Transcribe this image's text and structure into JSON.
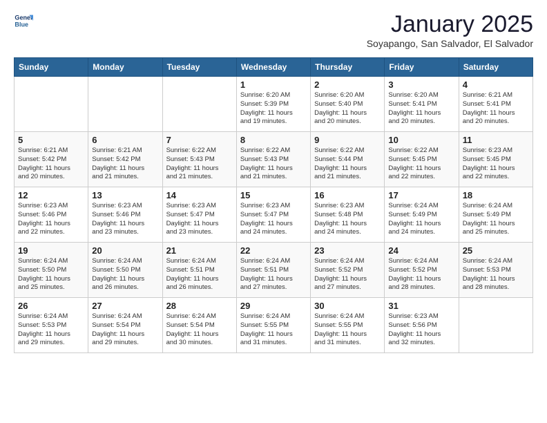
{
  "logo": {
    "line1": "General",
    "line2": "Blue"
  },
  "title": "January 2025",
  "location": "Soyapango, San Salvador, El Salvador",
  "days_of_week": [
    "Sunday",
    "Monday",
    "Tuesday",
    "Wednesday",
    "Thursday",
    "Friday",
    "Saturday"
  ],
  "weeks": [
    [
      {
        "day": "",
        "info": ""
      },
      {
        "day": "",
        "info": ""
      },
      {
        "day": "",
        "info": ""
      },
      {
        "day": "1",
        "info": "Sunrise: 6:20 AM\nSunset: 5:39 PM\nDaylight: 11 hours\nand 19 minutes."
      },
      {
        "day": "2",
        "info": "Sunrise: 6:20 AM\nSunset: 5:40 PM\nDaylight: 11 hours\nand 20 minutes."
      },
      {
        "day": "3",
        "info": "Sunrise: 6:20 AM\nSunset: 5:41 PM\nDaylight: 11 hours\nand 20 minutes."
      },
      {
        "day": "4",
        "info": "Sunrise: 6:21 AM\nSunset: 5:41 PM\nDaylight: 11 hours\nand 20 minutes."
      }
    ],
    [
      {
        "day": "5",
        "info": "Sunrise: 6:21 AM\nSunset: 5:42 PM\nDaylight: 11 hours\nand 20 minutes."
      },
      {
        "day": "6",
        "info": "Sunrise: 6:21 AM\nSunset: 5:42 PM\nDaylight: 11 hours\nand 21 minutes."
      },
      {
        "day": "7",
        "info": "Sunrise: 6:22 AM\nSunset: 5:43 PM\nDaylight: 11 hours\nand 21 minutes."
      },
      {
        "day": "8",
        "info": "Sunrise: 6:22 AM\nSunset: 5:43 PM\nDaylight: 11 hours\nand 21 minutes."
      },
      {
        "day": "9",
        "info": "Sunrise: 6:22 AM\nSunset: 5:44 PM\nDaylight: 11 hours\nand 21 minutes."
      },
      {
        "day": "10",
        "info": "Sunrise: 6:22 AM\nSunset: 5:45 PM\nDaylight: 11 hours\nand 22 minutes."
      },
      {
        "day": "11",
        "info": "Sunrise: 6:23 AM\nSunset: 5:45 PM\nDaylight: 11 hours\nand 22 minutes."
      }
    ],
    [
      {
        "day": "12",
        "info": "Sunrise: 6:23 AM\nSunset: 5:46 PM\nDaylight: 11 hours\nand 22 minutes."
      },
      {
        "day": "13",
        "info": "Sunrise: 6:23 AM\nSunset: 5:46 PM\nDaylight: 11 hours\nand 23 minutes."
      },
      {
        "day": "14",
        "info": "Sunrise: 6:23 AM\nSunset: 5:47 PM\nDaylight: 11 hours\nand 23 minutes."
      },
      {
        "day": "15",
        "info": "Sunrise: 6:23 AM\nSunset: 5:47 PM\nDaylight: 11 hours\nand 24 minutes."
      },
      {
        "day": "16",
        "info": "Sunrise: 6:23 AM\nSunset: 5:48 PM\nDaylight: 11 hours\nand 24 minutes."
      },
      {
        "day": "17",
        "info": "Sunrise: 6:24 AM\nSunset: 5:49 PM\nDaylight: 11 hours\nand 24 minutes."
      },
      {
        "day": "18",
        "info": "Sunrise: 6:24 AM\nSunset: 5:49 PM\nDaylight: 11 hours\nand 25 minutes."
      }
    ],
    [
      {
        "day": "19",
        "info": "Sunrise: 6:24 AM\nSunset: 5:50 PM\nDaylight: 11 hours\nand 25 minutes."
      },
      {
        "day": "20",
        "info": "Sunrise: 6:24 AM\nSunset: 5:50 PM\nDaylight: 11 hours\nand 26 minutes."
      },
      {
        "day": "21",
        "info": "Sunrise: 6:24 AM\nSunset: 5:51 PM\nDaylight: 11 hours\nand 26 minutes."
      },
      {
        "day": "22",
        "info": "Sunrise: 6:24 AM\nSunset: 5:51 PM\nDaylight: 11 hours\nand 27 minutes."
      },
      {
        "day": "23",
        "info": "Sunrise: 6:24 AM\nSunset: 5:52 PM\nDaylight: 11 hours\nand 27 minutes."
      },
      {
        "day": "24",
        "info": "Sunrise: 6:24 AM\nSunset: 5:52 PM\nDaylight: 11 hours\nand 28 minutes."
      },
      {
        "day": "25",
        "info": "Sunrise: 6:24 AM\nSunset: 5:53 PM\nDaylight: 11 hours\nand 28 minutes."
      }
    ],
    [
      {
        "day": "26",
        "info": "Sunrise: 6:24 AM\nSunset: 5:53 PM\nDaylight: 11 hours\nand 29 minutes."
      },
      {
        "day": "27",
        "info": "Sunrise: 6:24 AM\nSunset: 5:54 PM\nDaylight: 11 hours\nand 29 minutes."
      },
      {
        "day": "28",
        "info": "Sunrise: 6:24 AM\nSunset: 5:54 PM\nDaylight: 11 hours\nand 30 minutes."
      },
      {
        "day": "29",
        "info": "Sunrise: 6:24 AM\nSunset: 5:55 PM\nDaylight: 11 hours\nand 31 minutes."
      },
      {
        "day": "30",
        "info": "Sunrise: 6:24 AM\nSunset: 5:55 PM\nDaylight: 11 hours\nand 31 minutes."
      },
      {
        "day": "31",
        "info": "Sunrise: 6:23 AM\nSunset: 5:56 PM\nDaylight: 11 hours\nand 32 minutes."
      },
      {
        "day": "",
        "info": ""
      }
    ]
  ]
}
